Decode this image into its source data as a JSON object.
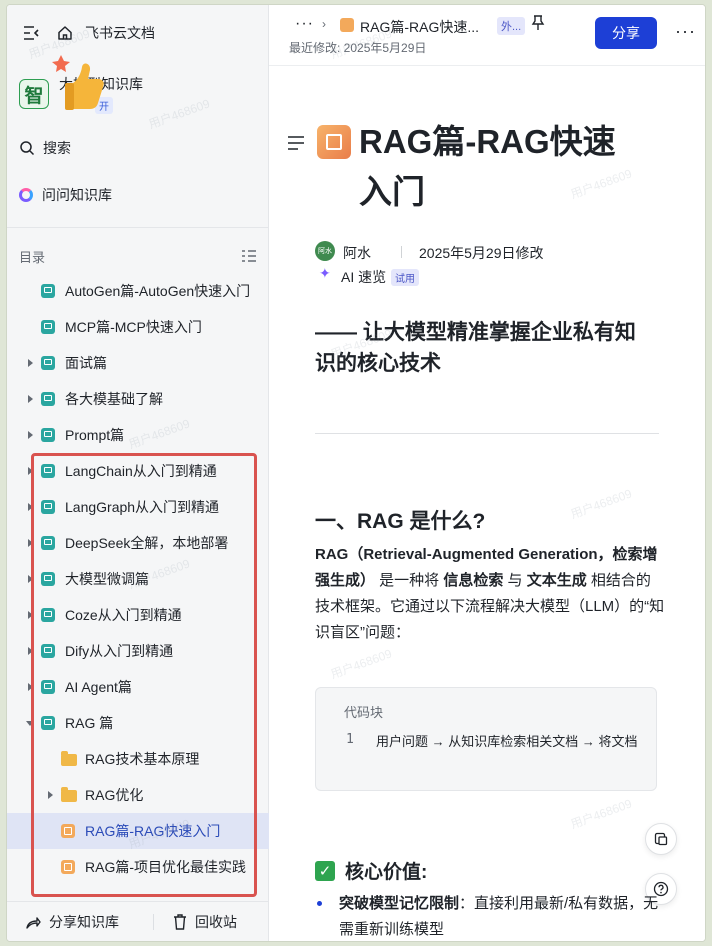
{
  "colors": {
    "accent": "#1d3fd6",
    "sidebar_bg": "#f5f6f7",
    "selected_bg": "#dfe4f5",
    "highlight_box": "#d9534f",
    "doc_icon": "#2aa6a0",
    "folder_icon": "#f0b847"
  },
  "sidebar": {
    "brand": "飞书云文档",
    "kb_logo_char": "智",
    "kb_name": "大模型知识库",
    "kb_badge": "开",
    "search_label": "搜索",
    "ask_label": "问问知识库",
    "toc_label": "目录",
    "items": [
      {
        "label": "AutoGen篇-AutoGen快速入门",
        "icon": "doc-icon",
        "caret": "none",
        "level": 0
      },
      {
        "label": "MCP篇-MCP快速入门",
        "icon": "doc-icon",
        "caret": "none",
        "level": 0
      },
      {
        "label": "面试篇",
        "icon": "doc-icon",
        "caret": "right",
        "level": 0
      },
      {
        "label": "各大模基础了解",
        "icon": "doc-icon",
        "caret": "right",
        "level": 0
      },
      {
        "label": "Prompt篇",
        "icon": "doc-icon",
        "caret": "right",
        "level": 0
      },
      {
        "label": "LangChain从入门到精通",
        "icon": "doc-icon",
        "caret": "right",
        "level": 0
      },
      {
        "label": "LangGraph从入门到精通",
        "icon": "doc-icon",
        "caret": "right",
        "level": 0
      },
      {
        "label": "DeepSeek全解，本地部署",
        "icon": "doc-icon",
        "caret": "right",
        "level": 0
      },
      {
        "label": "大模型微调篇",
        "icon": "doc-icon",
        "caret": "right",
        "level": 0
      },
      {
        "label": "Coze从入门到精通",
        "icon": "doc-icon",
        "caret": "right",
        "level": 0
      },
      {
        "label": "Dify从入门到精通",
        "icon": "doc-icon",
        "caret": "right",
        "level": 0
      },
      {
        "label": "AI Agent篇",
        "icon": "doc-icon",
        "caret": "right",
        "level": 0
      },
      {
        "label": "RAG 篇",
        "icon": "doc-icon",
        "caret": "down",
        "level": 0
      },
      {
        "label": "RAG技术基本原理",
        "icon": "folder-icon",
        "caret": "none",
        "level": 1
      },
      {
        "label": "RAG优化",
        "icon": "folder-icon",
        "caret": "right",
        "level": 1
      },
      {
        "label": "RAG篇-RAG快速入门",
        "icon": "rag-doc-icon",
        "caret": "none",
        "level": 1,
        "selected": true
      },
      {
        "label": "RAG篇-项目优化最佳实践",
        "icon": "rag-doc-icon",
        "caret": "none",
        "level": 1
      }
    ],
    "share_kb": "分享知识库",
    "recycle": "回收站"
  },
  "header": {
    "more": "···",
    "breadcrumb_title": "RAG篇-RAG快速...",
    "breadcrumb_tag": "外...",
    "last_modified": "最近修改: 2025年5月29日",
    "share_button": "分享",
    "more_button": "···"
  },
  "document": {
    "title_line1": "RAG篇-RAG快速",
    "title_line2": "入门",
    "author_avatar": "阿水",
    "author": "阿水",
    "modified": "2025年5月29日修改",
    "ai_label": "AI 速览",
    "ai_tag": "试用",
    "subtitle": "—— 让大模型精准掌握企业私有知识的核心技术",
    "h1": "一、RAG 是什么?",
    "para_bold1": "RAG（Retrieval-Augmented Generation，检索增强生成）",
    "para_text1": " 是一种将 ",
    "para_bold2": "信息检索",
    "para_text2": " 与 ",
    "para_bold3": "文本生成",
    "para_text3": " 相结合的技术框架。它通过以下流程解决大模型（LLM）的“知识盲区”问题：",
    "code_title": "代码块",
    "code_line_no": "1",
    "code_line": "用户问题 → 从知识库检索相关文档 → 将文档",
    "h2": "核心价值:",
    "bullet_bold": "突破模型记忆限制",
    "bullet_text": "：直接利用最新/私有数据，无需重新训练模型"
  },
  "watermark": "用户468609"
}
